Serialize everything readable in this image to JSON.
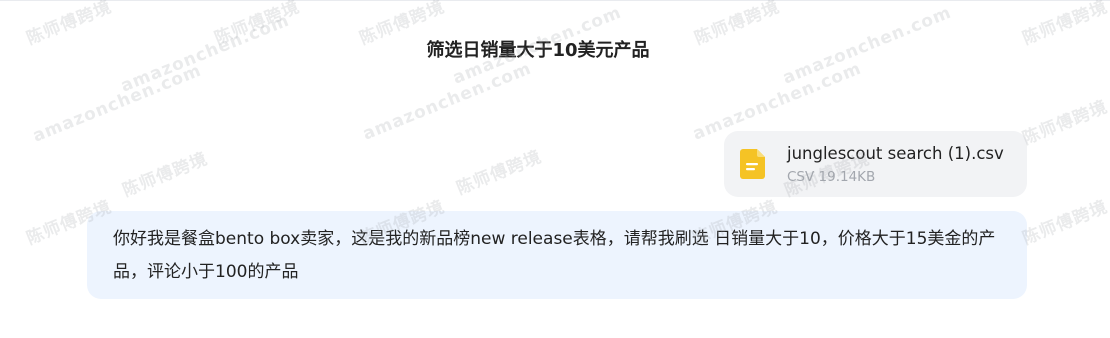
{
  "conversation": {
    "title": "筛选日销量大于10美元产品"
  },
  "attachment": {
    "file_name": "junglescout search (1).csv",
    "file_meta": "CSV 19.14KB",
    "icon": "document-icon",
    "icon_color": "#f5c325"
  },
  "message": {
    "text": "你好我是餐盒bento box卖家，这是我的新品榜new release表格，请帮我刷选 日销量大于10，价格大于15美金的产品，评论小于100的产品",
    "bubble_color": "#edf4fe"
  },
  "watermark": {
    "name": "陈师傅跨境",
    "site": "amazonchen.com"
  }
}
